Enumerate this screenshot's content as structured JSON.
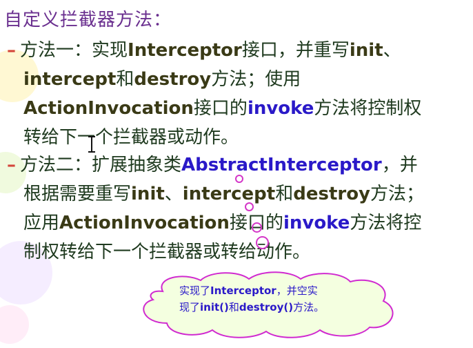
{
  "title": "自定义拦截器方法：",
  "bullet1": {
    "line1": {
      "pre": "方法一：实现",
      "kw": "Interceptor",
      "mid": "接口，并重写",
      "kw2": "init",
      "post": "、"
    },
    "line2": {
      "kw": "intercept",
      "mid": "和",
      "kw2": "destroy",
      "post": "方法；使用"
    },
    "line3": {
      "kw": "ActionInvocation",
      "mid": "接口的",
      "kw2": "invoke",
      "post": "方法将控制权"
    },
    "line4": "转给下一个拦截器或动作。"
  },
  "bullet2": {
    "line1": {
      "pre": "方法二：扩展抽象类",
      "kw": "AbstractInterceptor",
      "post": "，并"
    },
    "line2": {
      "pre": "根据需要重写",
      "kw": "init",
      "mid": "、",
      "kw2": "intercept",
      "mid2": "和",
      "kw3": "destroy",
      "post": "方法；"
    },
    "line3": {
      "pre": "应用",
      "kw": "ActionInvocation",
      "mid": "接口的",
      "kw2": "invoke",
      "post": "方法将控"
    },
    "line4": "制权转给下一个拦截器或转给动作。"
  },
  "callout": {
    "line1_pre": "实现了",
    "line1_kw": "Interceptor",
    "line1_post": "，并空实",
    "line2_pre": "现了",
    "line2_kw": "init()",
    "line2_mid": "和",
    "line2_kw2": "destroy()",
    "line2_post": "方法。"
  },
  "colors": {
    "title": "#6a2f8f",
    "body_text": "#1f3a1f",
    "keyword_dark": "#3a3a16",
    "keyword_blue": "#2a19c8",
    "dash": "#d4453a",
    "cloud_fill": "#f4ffe0",
    "cloud_stroke": "#d02ad0"
  }
}
